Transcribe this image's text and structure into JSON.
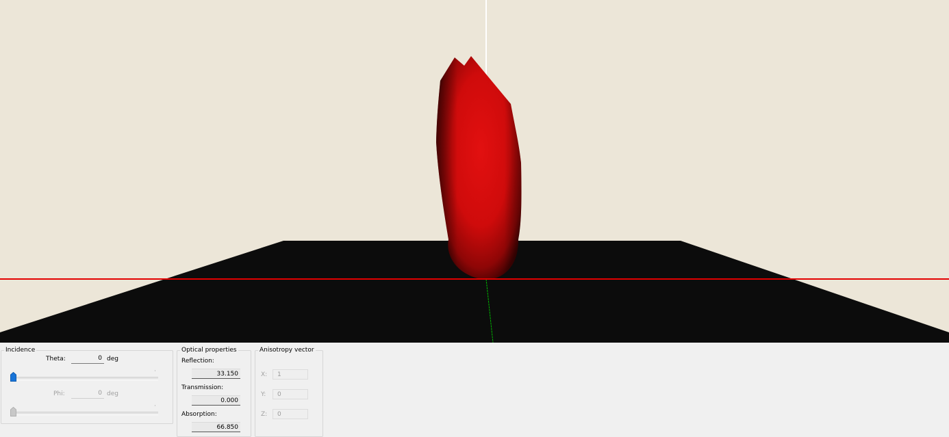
{
  "colors": {
    "background": "#ece6d8",
    "floor": "#0c0c0c",
    "lobe": "#d60b0b",
    "x_axis": "#e30000",
    "y_axis": "#ffffff",
    "z_axis": "#00b400",
    "slider_active": "#1874d8",
    "slider_disabled": "#c8c8c8"
  },
  "viewport": {
    "object": "red-scattering-lobe"
  },
  "incidence": {
    "title": "Incidence",
    "theta_label": "Theta:",
    "theta_value": "0",
    "theta_unit": "deg",
    "phi_label": "Phi:",
    "phi_value": "0",
    "phi_unit": "deg",
    "theta_slider_fraction": 0,
    "phi_slider_fraction": 0
  },
  "optical": {
    "title": "Optical properties",
    "reflection_label": "Reflection:",
    "reflection_value": "33.150",
    "transmission_label": "Transmission:",
    "transmission_value": "0.000",
    "absorption_label": "Absorption:",
    "absorption_value": "66.850"
  },
  "anisotropy": {
    "title": "Anisotropy vector",
    "x_label": "X:",
    "x_value": "1",
    "y_label": "Y:",
    "y_value": "0",
    "z_label": "Z:",
    "z_value": "0"
  }
}
